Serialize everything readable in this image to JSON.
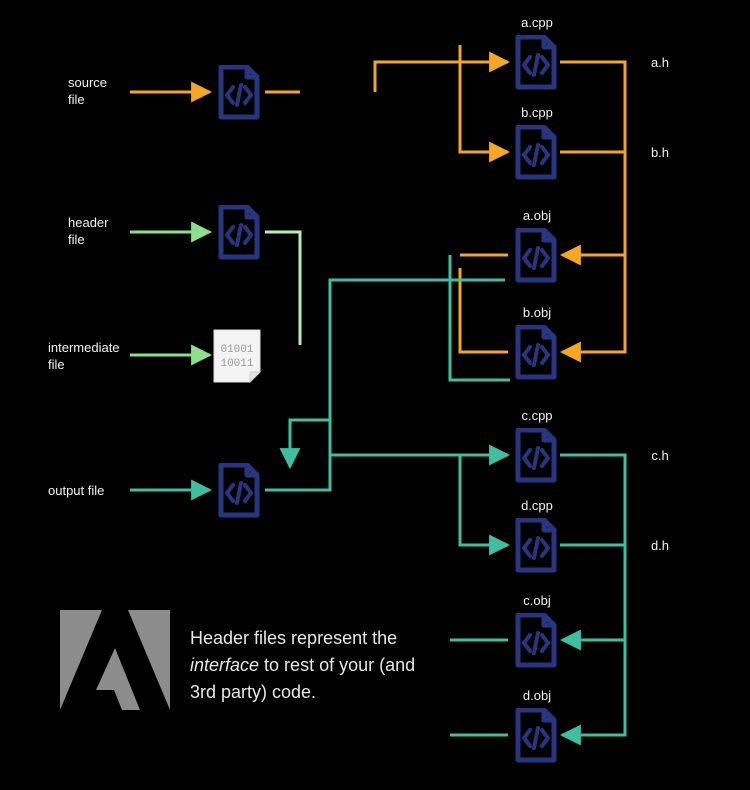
{
  "labels": {
    "source": "source\nfile",
    "header": "header\nfile",
    "intermediate": "intermediate\nfile",
    "output": "output file",
    "a_cpp": "a.cpp",
    "a_h": "a.h",
    "b_cpp": "b.cpp",
    "b_h": "b.h",
    "a_obj": "a.obj",
    "b_obj": "b.obj",
    "c_cpp": "c.cpp",
    "c_h": "c.h",
    "d_cpp": "d.cpp",
    "d_h": "d.h",
    "c_obj": "c.obj",
    "d_obj": "d.obj"
  },
  "binary_text": {
    "line1": "01001",
    "line2": "10011"
  },
  "caption": {
    "line1": "Header files represent the",
    "line2": "interface",
    "line2b": " to rest of your (and",
    "line3": "3rd party) code."
  },
  "colors": {
    "orange": "#f5a623",
    "green": "#8ce08c",
    "teal": "#3fbf9f",
    "tealDark": "#2fae8e",
    "navy": "#27367f",
    "lightGreen": "#b7f0b7"
  }
}
